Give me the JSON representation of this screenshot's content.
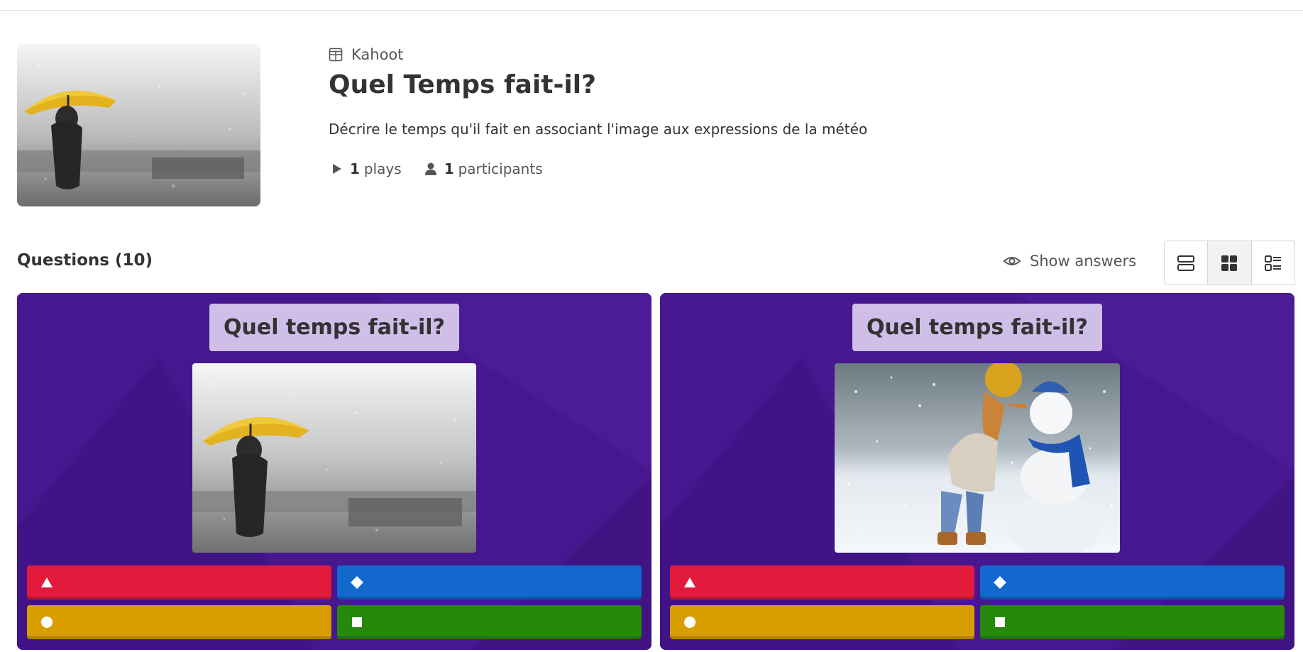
{
  "kahoot": {
    "type_label": "Kahoot",
    "title": "Quel Temps fait-il?",
    "description": "Décrire le temps qu'il fait en associant l'image aux expressions de la météo",
    "plays_count": "1",
    "plays_label": "plays",
    "participants_count": "1",
    "participants_label": "participants"
  },
  "questions_section": {
    "header": "Questions (10)",
    "show_answers_label": "Show answers",
    "view_modes": [
      "list-view-icon",
      "grid-view-icon",
      "detail-view-icon"
    ],
    "active_view": "grid-view-icon"
  },
  "question_cards": [
    {
      "title": "Quel temps fait-il?",
      "image": "rain-umbrella-image",
      "answers": [
        "triangle-icon",
        "diamond-icon",
        "circle-icon",
        "square-icon"
      ]
    },
    {
      "title": "Quel temps fait-il?",
      "image": "snowman-girl-image",
      "answers": [
        "triangle-icon",
        "diamond-icon",
        "circle-icon",
        "square-icon"
      ]
    }
  ],
  "colors": {
    "card_bg": "#46178f",
    "title_bg": "#cfbfe8",
    "answer_red": "#e21b3c",
    "answer_blue": "#1368ce",
    "answer_yellow": "#d89e00",
    "answer_green": "#26890c"
  }
}
